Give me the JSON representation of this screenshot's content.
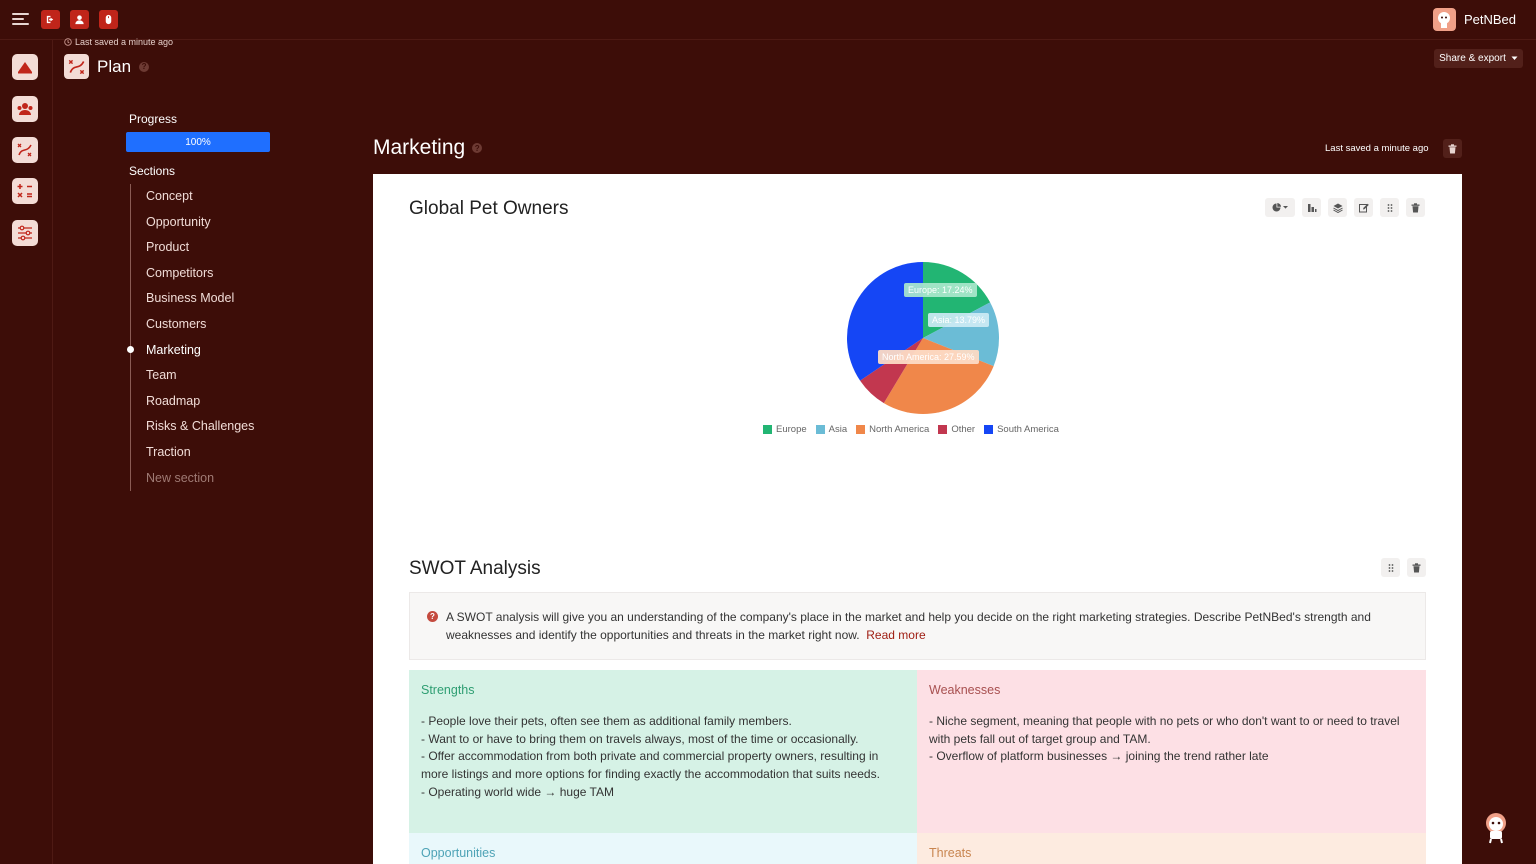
{
  "app": {
    "brand": "PetNBed"
  },
  "header": {
    "last_saved": "Last saved a minute ago",
    "plan_title": "Plan",
    "help": "?",
    "share_label": "Share & export"
  },
  "sidebar": {
    "progress_label": "Progress",
    "progress_value": 1.0,
    "progress_text": "100%",
    "sections_label": "Sections",
    "sections": [
      "Concept",
      "Opportunity",
      "Product",
      "Competitors",
      "Business Model",
      "Customers",
      "Marketing",
      "Team",
      "Roadmap",
      "Risks & Challenges",
      "Traction",
      "New section"
    ],
    "active_section": "Marketing"
  },
  "main": {
    "title": "Marketing",
    "help": "?",
    "last_saved": "Last saved a minute ago"
  },
  "chart_section": {
    "title": "Global Pet Owners"
  },
  "chart_data": {
    "type": "pie",
    "title": "Global Pet Owners",
    "slices": [
      {
        "name": "Europe",
        "value": 17.24,
        "color": "#22b573"
      },
      {
        "name": "Asia",
        "value": 13.79,
        "color": "#6bbcd6"
      },
      {
        "name": "North America",
        "value": 27.59,
        "color": "#f0874a"
      },
      {
        "name": "Other",
        "value": 6.9,
        "color": "#c2374f"
      },
      {
        "name": "South America",
        "value": 34.48,
        "color": "#1546f5"
      }
    ],
    "data_labels": [
      "Europe: 17.24%",
      "Asia: 13.79%",
      "North America: 27.59%"
    ],
    "legend_position": "bottom"
  },
  "swot": {
    "title": "SWOT Analysis",
    "info_text": "A SWOT analysis will give you an understanding of the company's place in the market and help you decide on the right marketing strategies. Describe PetNBed's strength and weaknesses and identify the opportunities and threats in the market right now.",
    "read_more": "Read more",
    "strengths": {
      "title": "Strengths",
      "text": "- People love their pets, often see them as additional family members.\n- Want to or have to bring them on travels always, most of the time or occasionally.\n- Offer accommodation from both private and commercial property owners, resulting in more listings and more options for finding exactly the accommodation that suits needs.\n- Operating world wide → huge TAM"
    },
    "weaknesses": {
      "title": "Weaknesses",
      "text": "- Niche segment, meaning that people with no pets or who don't want to or need to travel with pets fall out of target group and TAM.\n- Overflow of platform businesses → joining the trend rather late"
    },
    "opportunities": {
      "title": "Opportunities"
    },
    "threats": {
      "title": "Threats"
    }
  },
  "colors": {
    "background": "#3d0d08",
    "accent_red": "#c0251a",
    "progress_blue": "#1f6fff"
  }
}
